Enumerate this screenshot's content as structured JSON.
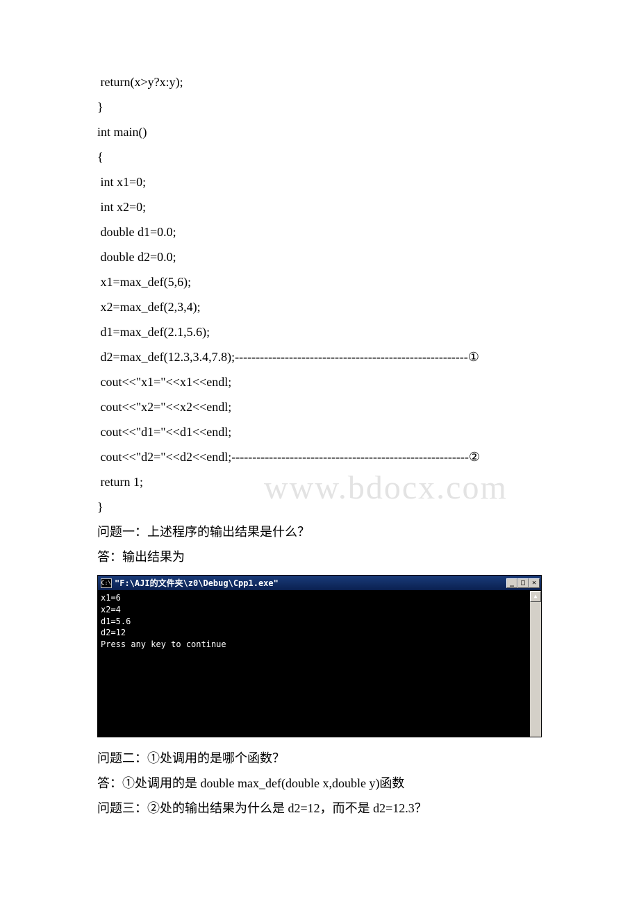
{
  "watermark": "www.bdocx.com",
  "code": {
    "l1": " return(x>y?x:y);",
    "l2": "}",
    "l3": "int main()",
    "l4": "{",
    "l5": " int x1=0;",
    "l6": " int x2=0;",
    "l7": " double d1=0.0;",
    "l8": " double d2=0.0;",
    "l9": " x1=max_def(5,6);",
    "l10": " x2=max_def(2,3,4);",
    "l11": " d1=max_def(2.1,5.6);",
    "l12": " d2=max_def(12.3,3.4,7.8);--------------------------------------------------------①",
    "l13": " cout<<\"x1=\"<<x1<<endl;",
    "l14": " cout<<\"x2=\"<<x2<<endl;",
    "l15": " cout<<\"d1=\"<<d1<<endl;",
    "l16": " cout<<\"d2=\"<<d2<<endl;---------------------------------------------------------②",
    "l17": " return 1;",
    "l18": "}"
  },
  "questions": {
    "q1": "问题一：上述程序的输出结果是什么？",
    "a1": "答：输出结果为",
    "q2": "问题二：①处调用的是哪个函数？",
    "a2": "答：①处调用的是 double max_def(double x,double y)函数",
    "q3": "问题三：②处的输出结果为什么是 d2=12，而不是 d2=12.3？"
  },
  "console": {
    "icon_text": "C:\\",
    "title": "\"F:\\AJI的文件夹\\z0\\Debug\\Cpp1.exe\"",
    "output": "x1=6\nx2=4\nd1=5.6\nd2=12\nPress any key to continue",
    "minimize": "_",
    "maximize": "□",
    "close": "✕",
    "up_arrow": "▲"
  }
}
